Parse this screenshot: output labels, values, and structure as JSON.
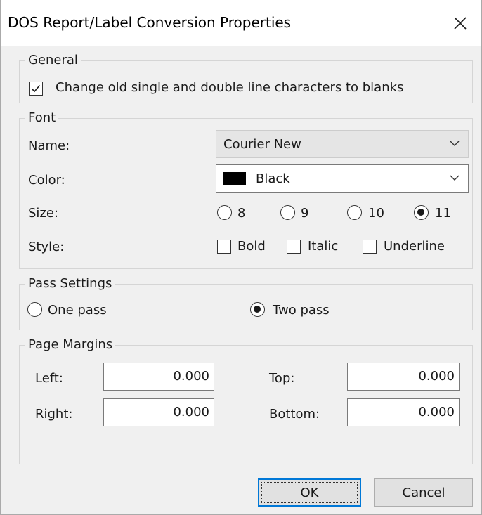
{
  "window": {
    "title": "DOS Report/Label Conversion Properties",
    "close_icon": "close-icon"
  },
  "general": {
    "title": "General",
    "change_lines": {
      "label": "Change old single and double line characters to blanks",
      "checked": true
    }
  },
  "font": {
    "title": "Font",
    "name_label": "Name:",
    "name_value": "Courier New",
    "color_label": "Color:",
    "color_value": "Black",
    "color_swatch": "#000000",
    "size_label": "Size:",
    "sizes": [
      {
        "label": "8",
        "selected": false
      },
      {
        "label": "9",
        "selected": false
      },
      {
        "label": "10",
        "selected": false
      },
      {
        "label": "11",
        "selected": true
      }
    ],
    "style_label": "Style:",
    "styles": [
      {
        "label": "Bold",
        "checked": false
      },
      {
        "label": "Italic",
        "checked": false
      },
      {
        "label": "Underline",
        "checked": false
      }
    ]
  },
  "pass": {
    "title": "Pass Settings",
    "one_pass": {
      "label": "One pass",
      "selected": false
    },
    "two_pass": {
      "label": "Two pass",
      "selected": true
    }
  },
  "margins": {
    "title": "Page Margins",
    "left_label": "Left:",
    "left_value": "0.000",
    "top_label": "Top:",
    "top_value": "0.000",
    "right_label": "Right:",
    "right_value": "0.000",
    "bottom_label": "Bottom:",
    "bottom_value": "0.000"
  },
  "buttons": {
    "ok": "OK",
    "cancel": "Cancel"
  },
  "colors": {
    "focus_border": "#0078d7",
    "dialog_bg": "#f0f0f0"
  }
}
